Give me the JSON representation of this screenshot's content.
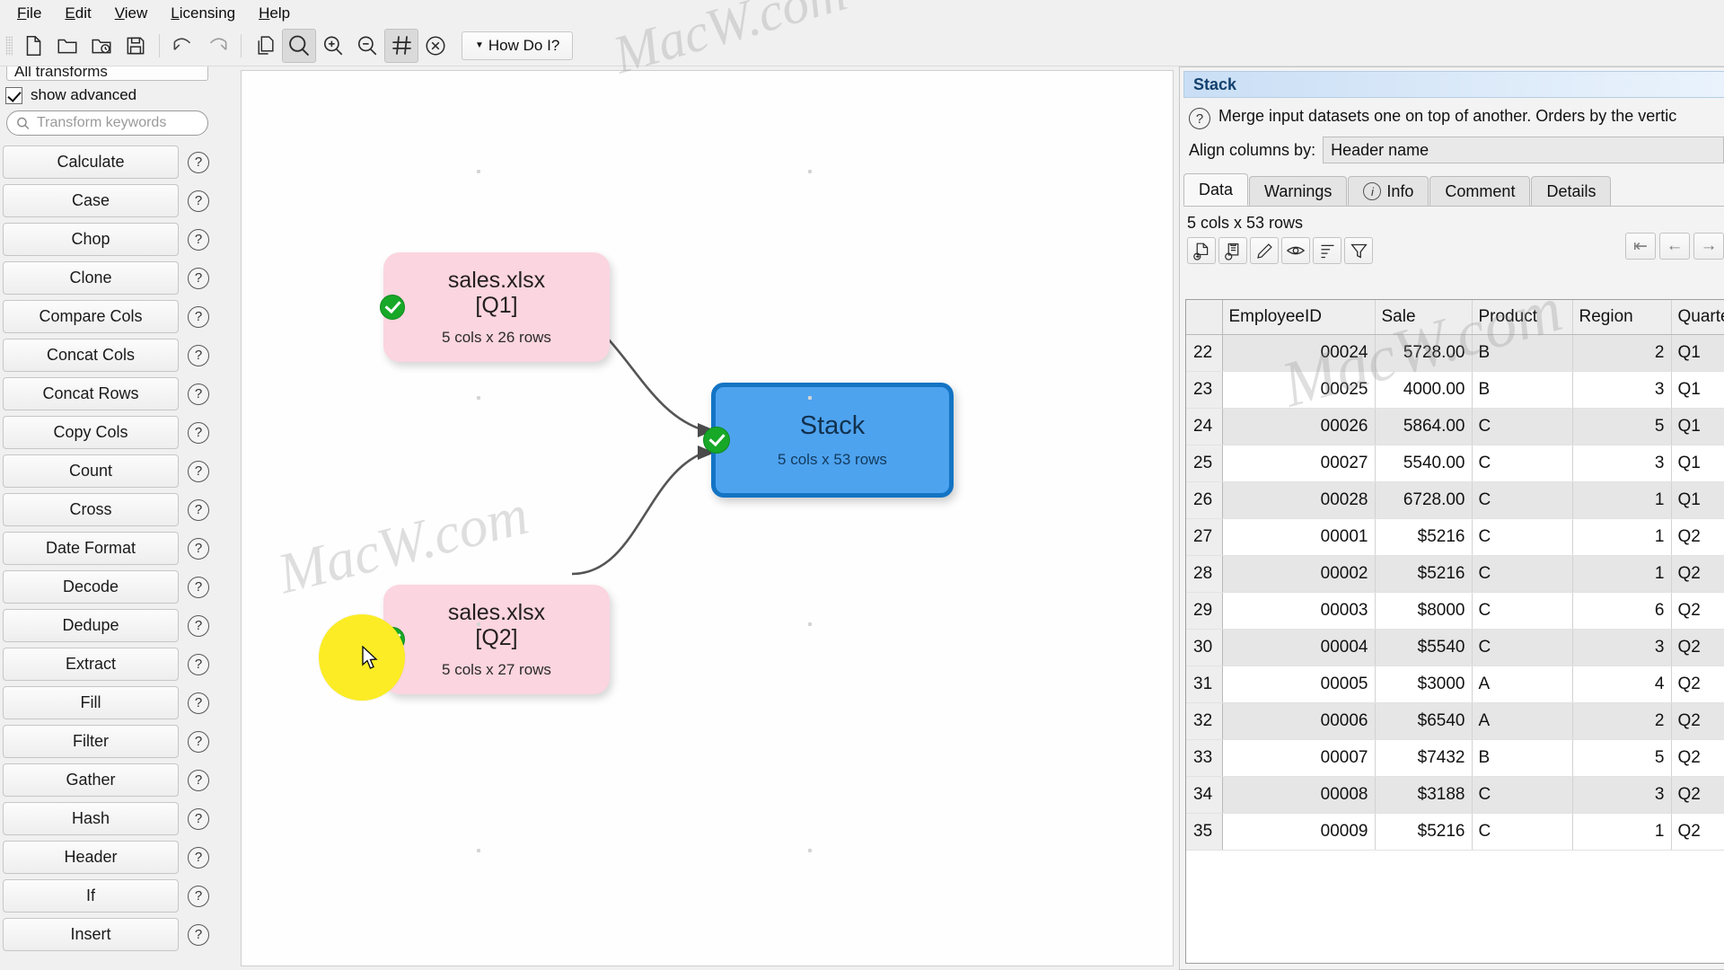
{
  "menubar": {
    "items": [
      {
        "label": "File",
        "accel": "F"
      },
      {
        "label": "Edit",
        "accel": "E"
      },
      {
        "label": "View",
        "accel": "V"
      },
      {
        "label": "Licensing",
        "accel": "L"
      },
      {
        "label": "Help",
        "accel": "H"
      }
    ]
  },
  "toolbar": {
    "buttons": [
      {
        "name": "new-file-icon",
        "tip": "New"
      },
      {
        "name": "open-folder-icon",
        "tip": "Open"
      },
      {
        "name": "open-recent-icon",
        "tip": "Open recent"
      },
      {
        "name": "save-icon",
        "tip": "Save"
      },
      {
        "name": "undo-icon",
        "tip": "Undo"
      },
      {
        "name": "redo-icon",
        "tip": "Redo"
      },
      {
        "name": "copy-icon",
        "tip": "Copy"
      },
      {
        "name": "zoom-fit-icon",
        "tip": "Zoom"
      },
      {
        "name": "zoom-in-icon",
        "tip": "Zoom in"
      },
      {
        "name": "zoom-out-icon",
        "tip": "Zoom out"
      },
      {
        "name": "grid-icon",
        "tip": "Snap to grid"
      },
      {
        "name": "cancel-icon",
        "tip": "Cancel"
      }
    ],
    "how_do_i_label": "How Do I?"
  },
  "left_panel": {
    "all_transforms_label": "All transforms",
    "show_advanced_label": "show advanced",
    "search_placeholder": "Transform keywords",
    "search_value": "",
    "help_glyph": "?",
    "transforms": [
      "Calculate",
      "Case",
      "Chop",
      "Clone",
      "Compare Cols",
      "Concat Cols",
      "Concat Rows",
      "Copy Cols",
      "Count",
      "Cross",
      "Date Format",
      "Decode",
      "Dedupe",
      "Extract",
      "Fill",
      "Filter",
      "Gather",
      "Hash",
      "Header",
      "If",
      "Insert"
    ]
  },
  "canvas": {
    "nodes": [
      {
        "name": "node-sales-q1",
        "title_line1": "sales.xlsx",
        "title_line2": "[Q1]",
        "subtitle": "5 cols x 26 rows",
        "status": "ok",
        "color": "#fbd5e0"
      },
      {
        "name": "node-sales-q2",
        "title_line1": "sales.xlsx",
        "title_line2": "[Q2]",
        "subtitle": "5 cols x 27 rows",
        "status": "ok",
        "color": "#fbd5e0"
      },
      {
        "name": "node-stack",
        "title_line1": "Stack",
        "title_line2": "",
        "subtitle": "5 cols x 53 rows",
        "status": "ok",
        "color": "#4ea3ef"
      }
    ],
    "watermarks": [
      "MacW.com",
      "MacW.com"
    ]
  },
  "right_panel": {
    "title": "Stack",
    "description": "Merge input datasets one on top of another. Orders by the vertic",
    "help_glyph": "?",
    "align_label": "Align columns by:",
    "align_value": "Header name",
    "tabs": [
      {
        "label": "Data",
        "selected": true,
        "icon": ""
      },
      {
        "label": "Warnings",
        "selected": false,
        "icon": ""
      },
      {
        "label": "Info",
        "selected": false,
        "icon": "info-icon"
      },
      {
        "label": "Comment",
        "selected": false,
        "icon": ""
      },
      {
        "label": "Details",
        "selected": false,
        "icon": ""
      }
    ],
    "row_count_label": "5 cols x 53 rows",
    "grid_tools": [
      {
        "name": "export-file-icon"
      },
      {
        "name": "copy-clipboard-icon"
      },
      {
        "name": "edit-pencil-icon"
      },
      {
        "name": "preview-eye-icon"
      },
      {
        "name": "sort-icon"
      },
      {
        "name": "filter-funnel-icon"
      }
    ],
    "nav_buttons": [
      {
        "name": "first-page-icon",
        "glyph": "⇤"
      },
      {
        "name": "previous-page-icon",
        "glyph": "←"
      },
      {
        "name": "next-page-icon",
        "glyph": "→"
      }
    ],
    "table": {
      "columns": [
        "EmployeeID",
        "Sale",
        "Product",
        "Region",
        "Quarter"
      ],
      "rows": [
        {
          "n": "22",
          "EmployeeID": "00024",
          "Sale": "5728.00",
          "Product": "B",
          "Region": "2",
          "Quarter": "Q1"
        },
        {
          "n": "23",
          "EmployeeID": "00025",
          "Sale": "4000.00",
          "Product": "B",
          "Region": "3",
          "Quarter": "Q1"
        },
        {
          "n": "24",
          "EmployeeID": "00026",
          "Sale": "5864.00",
          "Product": "C",
          "Region": "5",
          "Quarter": "Q1"
        },
        {
          "n": "25",
          "EmployeeID": "00027",
          "Sale": "5540.00",
          "Product": "C",
          "Region": "3",
          "Quarter": "Q1"
        },
        {
          "n": "26",
          "EmployeeID": "00028",
          "Sale": "6728.00",
          "Product": "C",
          "Region": "1",
          "Quarter": "Q1"
        },
        {
          "n": "27",
          "EmployeeID": "00001",
          "Sale": "$5216",
          "Product": "C",
          "Region": "1",
          "Quarter": "Q2"
        },
        {
          "n": "28",
          "EmployeeID": "00002",
          "Sale": "$5216",
          "Product": "C",
          "Region": "1",
          "Quarter": "Q2"
        },
        {
          "n": "29",
          "EmployeeID": "00003",
          "Sale": "$8000",
          "Product": "C",
          "Region": "6",
          "Quarter": "Q2"
        },
        {
          "n": "30",
          "EmployeeID": "00004",
          "Sale": "$5540",
          "Product": "C",
          "Region": "3",
          "Quarter": "Q2"
        },
        {
          "n": "31",
          "EmployeeID": "00005",
          "Sale": "$3000",
          "Product": "A",
          "Region": "4",
          "Quarter": "Q2"
        },
        {
          "n": "32",
          "EmployeeID": "00006",
          "Sale": "$6540",
          "Product": "A",
          "Region": "2",
          "Quarter": "Q2"
        },
        {
          "n": "33",
          "EmployeeID": "00007",
          "Sale": "$7432",
          "Product": "B",
          "Region": "5",
          "Quarter": "Q2"
        },
        {
          "n": "34",
          "EmployeeID": "00008",
          "Sale": "$3188",
          "Product": "C",
          "Region": "3",
          "Quarter": "Q2"
        },
        {
          "n": "35",
          "EmployeeID": "00009",
          "Sale": "$5216",
          "Product": "C",
          "Region": "1",
          "Quarter": "Q2"
        }
      ]
    }
  },
  "colors": {
    "accent_blue": "#4ea3ef",
    "node_pink": "#fbd5e0",
    "status_green": "#17a828",
    "highlight_yellow": "#fbec25",
    "panel_bg": "#f0f0f0"
  }
}
